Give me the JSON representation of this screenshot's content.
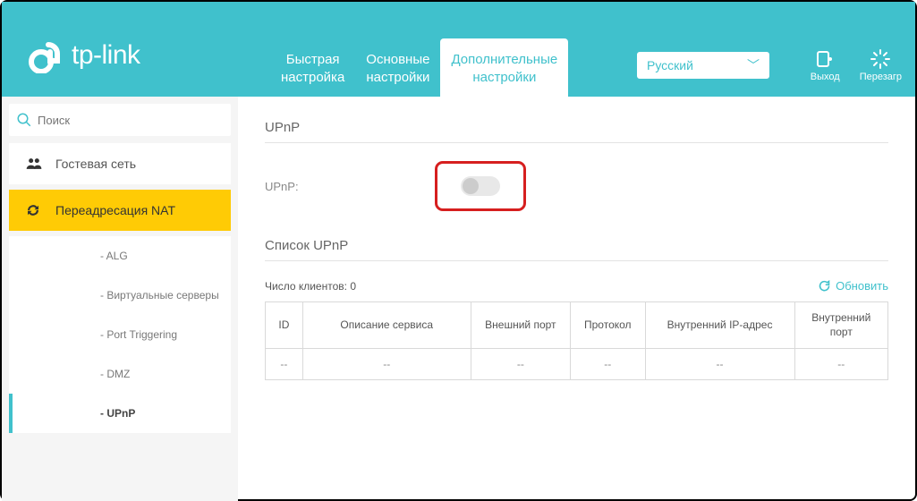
{
  "brand": "tp-link",
  "header": {
    "tabs": [
      {
        "line1": "Быстрая",
        "line2": "настройка"
      },
      {
        "line1": "Основные",
        "line2": "настройки"
      },
      {
        "line1": "Дополнительные",
        "line2": "настройки"
      }
    ],
    "language": "Русский",
    "actions": {
      "logout": "Выход",
      "reboot": "Перезагр"
    }
  },
  "sidebar": {
    "search_placeholder": "Поиск",
    "items": [
      {
        "label": "Гостевая сеть",
        "icon": "users"
      },
      {
        "label": "Переадресация NAT",
        "icon": "refresh"
      }
    ],
    "sub_items": [
      {
        "label": "- ALG"
      },
      {
        "label": "- Виртуальные серверы"
      },
      {
        "label": "- Port Triggering"
      },
      {
        "label": "- DMZ"
      },
      {
        "label": "- UPnP"
      }
    ]
  },
  "main": {
    "section1_title": "UPnP",
    "upnp_label": "UPnP:",
    "section2_title": "Список UPnP",
    "clients_label": "Число клиентов: 0",
    "refresh_label": "Обновить",
    "columns": [
      "ID",
      "Описание сервиса",
      "Внешний порт",
      "Протокол",
      "Внутренний IP-адрес",
      "Внутренний порт"
    ],
    "empty_cell": "--"
  }
}
